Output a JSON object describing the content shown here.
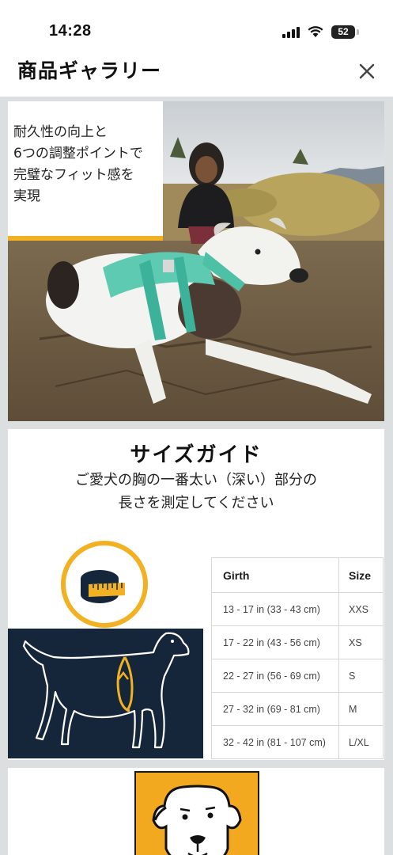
{
  "status_bar": {
    "time": "14:28",
    "battery": "52"
  },
  "header": {
    "title": "商品ギャラリー",
    "close_icon": "close-icon"
  },
  "photo_card": {
    "caption": "耐久性の向上と\n6つの調整ポイントで\n完璧なフィット感を\n実現",
    "accent_color": "#f2b123"
  },
  "size_guide": {
    "title": "サイズガイド",
    "subtitle": "ご愛犬の胸の一番太い（深い）部分の\n長さを測定してください",
    "table": {
      "headers": [
        "Girth",
        "Size"
      ],
      "rows": [
        [
          "13 - 17 in (33 - 43 cm)",
          "XXS"
        ],
        [
          "17 - 22 in (43 - 56 cm)",
          "XS"
        ],
        [
          "22 - 27 in (56 - 69 cm)",
          "S"
        ],
        [
          "27 - 32 in (69 - 81 cm)",
          "M"
        ],
        [
          "32 - 42 in (81 - 107 cm)",
          "L/XL"
        ]
      ]
    },
    "icons": [
      "measuring-tape-icon",
      "dog-outline-icon"
    ],
    "colors": {
      "navy": "#16263a",
      "gold": "#f2b123"
    }
  },
  "logo_card": {
    "icon": "dog-face-logo-icon",
    "background": "#f2a81f"
  }
}
